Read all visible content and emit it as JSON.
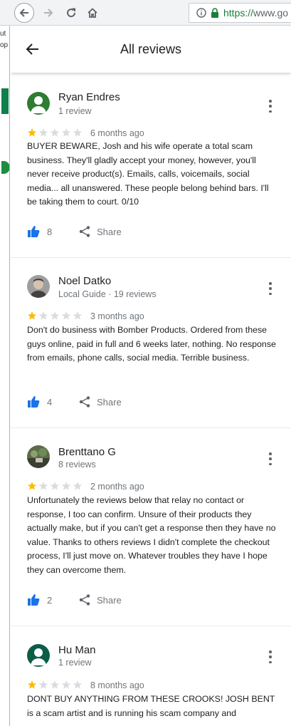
{
  "browser": {
    "url": "https://www.go",
    "url_scheme": "https://",
    "url_rest": "www.go"
  },
  "background_page": {
    "left_strip_texts": [
      "ut",
      "op"
    ]
  },
  "panel": {
    "title": "All reviews"
  },
  "reviews": [
    {
      "name": "Ryan Endres",
      "meta": "1 review",
      "rating": 1,
      "age": "6 months ago",
      "text": "BUYER BEWARE, Josh and his wife operate a total scam business. They'll gladly accept your money, however, you'll never receive product(s). Emails, calls, voicemails, social media... all unanswered. These people belong behind bars. I'll be taking them to court. 0/10",
      "likes": "8",
      "share_label": "Share",
      "avatar_color": "#2e7d32"
    },
    {
      "name": "Noel Datko",
      "meta": "Local Guide · 19 reviews",
      "rating": 1,
      "age": "3 months ago",
      "text": "Don't do business with Bomber Products. Ordered from these guys online, paid in full and 6 weeks later, nothing. No response from emails, phone calls, social media. Terrible business.",
      "likes": "4",
      "share_label": "Share",
      "avatar_color": "#8d8d8d"
    },
    {
      "name": "Brenttano G",
      "meta": "8 reviews",
      "rating": 1,
      "age": "2 months ago",
      "text": "Unfortunately the reviews below that relay no contact or response, I too can confirm.  Unsure of their products they actually make, but if you can't get a response then they have no value.  Thanks to others reviews I didn't complete the checkout process, I'll just move on.  Whatever troubles they have I hope they can overcome them.",
      "likes": "2",
      "share_label": "Share",
      "avatar_color": "#4a5a3a"
    },
    {
      "name": "Hu Man",
      "meta": "1 review",
      "rating": 1,
      "age": "8 months ago",
      "text": "DONT BUY ANYTHING FROM THESE CROOKS! JOSH BENT is a scam artist and is running his scam company and",
      "likes": "",
      "share_label": "Share",
      "avatar_color": "#0b5d47"
    }
  ],
  "colors": {
    "star_filled": "#fbbc04",
    "star_empty": "#dadce0",
    "like_blue": "#1a73e8",
    "secure_green": "#188038"
  }
}
